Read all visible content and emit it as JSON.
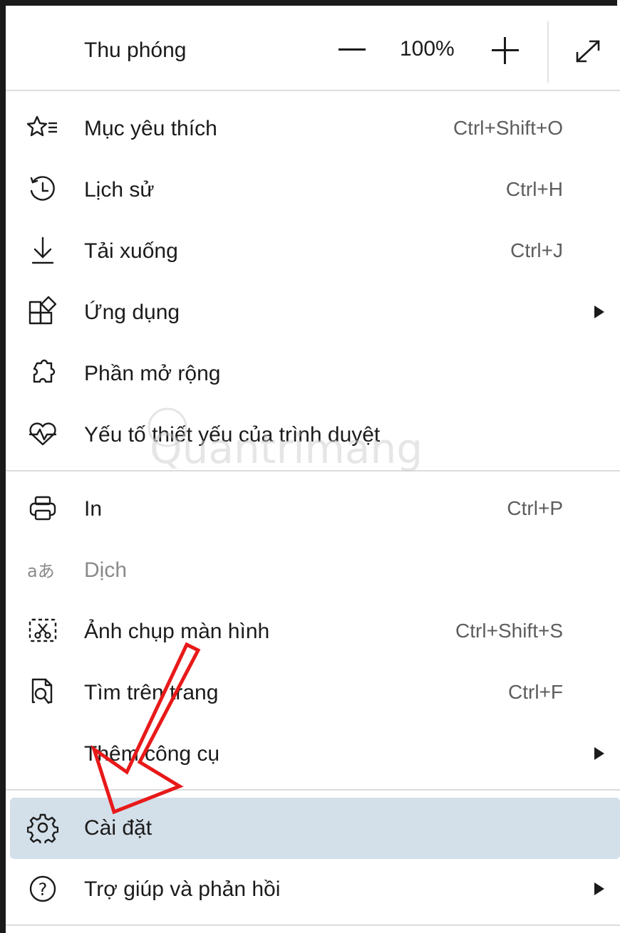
{
  "zoom": {
    "label": "Thu phóng",
    "value": "100%"
  },
  "items": [
    {
      "label": "Mục yêu thích",
      "shortcut": "Ctrl+Shift+O",
      "icon": "favorites-star-icon"
    },
    {
      "label": "Lịch sử",
      "shortcut": "Ctrl+H",
      "icon": "history-icon"
    },
    {
      "label": "Tải xuống",
      "shortcut": "Ctrl+J",
      "icon": "download-icon"
    },
    {
      "label": "Ứng dụng",
      "shortcut": "",
      "icon": "apps-icon",
      "submenu": true
    },
    {
      "label": "Phần mở rộng",
      "shortcut": "",
      "icon": "extensions-puzzle-icon"
    },
    {
      "label": "Yếu tố thiết yếu của trình duyệt",
      "shortcut": "",
      "icon": "heart-pulse-icon"
    },
    {
      "label": "In",
      "shortcut": "Ctrl+P",
      "icon": "printer-icon"
    },
    {
      "label": "Dịch",
      "shortcut": "",
      "icon": "translate-icon",
      "disabled": true
    },
    {
      "label": "Ảnh chụp màn hình",
      "shortcut": "Ctrl+Shift+S",
      "icon": "screenshot-scissors-icon"
    },
    {
      "label": "Tìm trên trang",
      "shortcut": "Ctrl+F",
      "icon": "find-on-page-icon"
    },
    {
      "label": "Thêm công cụ",
      "shortcut": "",
      "icon": "",
      "submenu": true
    },
    {
      "label": "Cài đặt",
      "shortcut": "",
      "icon": "settings-gear-icon",
      "highlighted": true
    },
    {
      "label": "Trợ giúp và phản hồi",
      "shortcut": "",
      "icon": "help-question-icon",
      "submenu": true
    }
  ],
  "colors": {
    "highlight": "#d3dfe9",
    "annotation_arrow": "#e81919",
    "shortcut_text": "#5d5d5d"
  },
  "watermark_text": "Quantrimang"
}
